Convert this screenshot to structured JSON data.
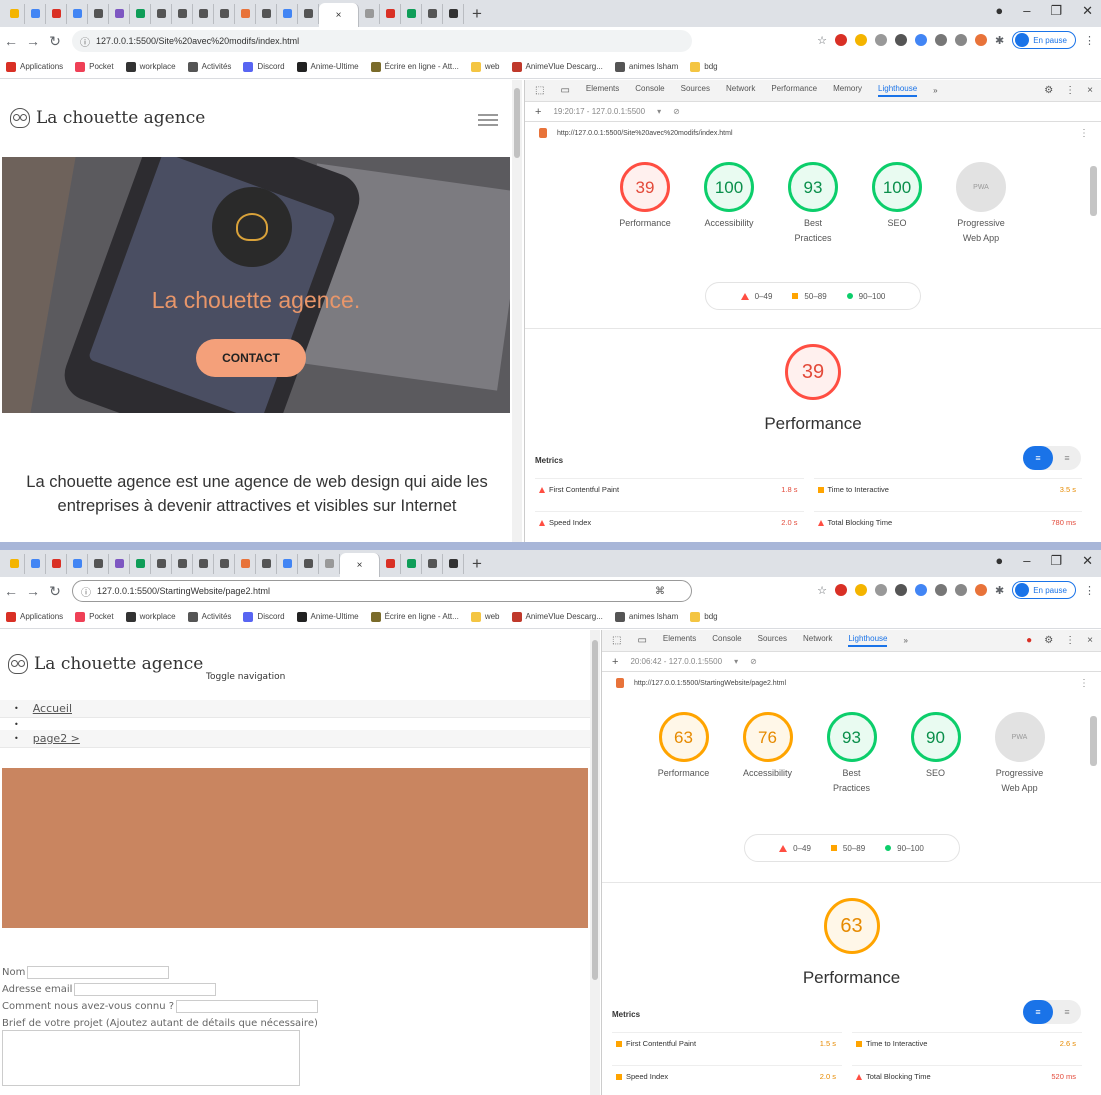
{
  "window1": {
    "address": "127.0.0.1:5500/Site%20avec%20modifs/index.html",
    "tab_close": "×",
    "bookmarks": [
      {
        "label": "Applications",
        "color": "#d93025"
      },
      {
        "label": "Pocket",
        "color": "#ef4056"
      },
      {
        "label": "workplace",
        "color": "#333333"
      },
      {
        "label": "Activités",
        "color": "#555555"
      },
      {
        "label": "Discord",
        "color": "#5865f2"
      },
      {
        "label": "Anime-Ultime",
        "color": "#222222"
      },
      {
        "label": "Écrire en ligne - Att...",
        "color": "#7a6b2a"
      },
      {
        "label": "web",
        "color": "#f4c542"
      },
      {
        "label": "AnimeVlue Descarg...",
        "color": "#c0392b"
      },
      {
        "label": "animes lsham",
        "color": "#555555"
      },
      {
        "label": "bdg",
        "color": "#f4c542"
      }
    ],
    "profile_status": "En pause",
    "page": {
      "brand": "La chouette agence",
      "hero_title": "La chouette agence.",
      "cta": "CONTACT",
      "description": "La chouette agence est une agence de web design qui aide les entreprises à devenir attractives et visibles sur Internet"
    },
    "devtools": {
      "tabs": [
        "Elements",
        "Console",
        "Sources",
        "Network",
        "Performance",
        "Memory",
        "Lighthouse"
      ],
      "more": "»",
      "report_time": "19:20:17 - 127.0.0.1:5500",
      "url": "http://127.0.0.1:5500/Site%20avec%20modifs/index.html",
      "scores": [
        {
          "label": "Performance",
          "value": "39",
          "status": "red"
        },
        {
          "label": "Accessibility",
          "value": "100",
          "status": "green"
        },
        {
          "label": "Best Practices",
          "value": "93",
          "status": "green"
        },
        {
          "label": "SEO",
          "value": "100",
          "status": "green"
        },
        {
          "label": "Progressive Web App",
          "value": "PWA",
          "status": "grey"
        }
      ],
      "legend": [
        "0–49",
        "50–89",
        "90–100"
      ],
      "big_score": "39",
      "big_title": "Performance",
      "metrics_label": "Metrics",
      "metrics": [
        {
          "name": "First Contentful Paint",
          "value": "1.8 s",
          "status": "red"
        },
        {
          "name": "Time to Interactive",
          "value": "3.5 s",
          "status": "orange"
        },
        {
          "name": "Speed Index",
          "value": "2.0 s",
          "status": "red"
        },
        {
          "name": "Total Blocking Time",
          "value": "780 ms",
          "status": "red"
        }
      ]
    }
  },
  "window2": {
    "address": "127.0.0.1:5500/StartingWebsite/page2.html",
    "tab_close": "×",
    "profile_status": "En pause",
    "page": {
      "brand": "La chouette agence",
      "toggle_nav": "Toggle navigation",
      "nav": [
        "Accueil",
        "page2 >"
      ],
      "form": {
        "name_label": "Nom",
        "email_label": "Adresse email",
        "source_label": "Comment nous avez-vous connu ?",
        "brief_label": "Brief de votre projet (Ajoutez autant de détails que nécessaire)"
      }
    },
    "devtools": {
      "tabs": [
        "Elements",
        "Console",
        "Sources",
        "Network",
        "Lighthouse"
      ],
      "more": "»",
      "report_time": "20:06:42 - 127.0.0.1:5500",
      "url": "http://127.0.0.1:5500/StartingWebsite/page2.html",
      "scores": [
        {
          "label": "Performance",
          "value": "63",
          "status": "orange"
        },
        {
          "label": "Accessibility",
          "value": "76",
          "status": "orange"
        },
        {
          "label": "Best Practices",
          "value": "93",
          "status": "green"
        },
        {
          "label": "SEO",
          "value": "90",
          "status": "green"
        },
        {
          "label": "Progressive Web App",
          "value": "PWA",
          "status": "grey"
        }
      ],
      "legend": [
        "0–49",
        "50–89",
        "90–100"
      ],
      "big_score": "63",
      "big_title": "Performance",
      "metrics_label": "Metrics",
      "metrics": [
        {
          "name": "First Contentful Paint",
          "value": "1.5 s",
          "status": "orange"
        },
        {
          "name": "Time to Interactive",
          "value": "2.6 s",
          "status": "orange"
        },
        {
          "name": "Speed Index",
          "value": "2.0 s",
          "status": "orange"
        },
        {
          "name": "Total Blocking Time",
          "value": "520 ms",
          "status": "red"
        }
      ]
    }
  }
}
